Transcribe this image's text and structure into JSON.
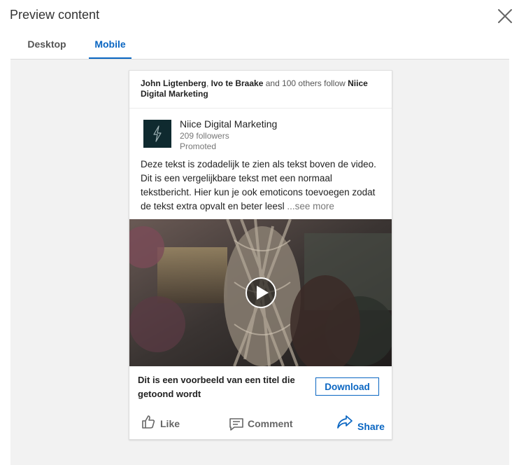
{
  "modal": {
    "title": "Preview content"
  },
  "tabs": [
    {
      "label": "Desktop",
      "active": false
    },
    {
      "label": "Mobile",
      "active": true
    }
  ],
  "post": {
    "social": {
      "name1": "John Ligtenberg",
      "sep": ", ",
      "name2": "Ivo te Braake",
      "rest": " and 100 others follow ",
      "company": "Niice Digital Marketing"
    },
    "company": {
      "name": "Niice Digital Marketing",
      "followers": "209 followers",
      "promoted": "Promoted"
    },
    "text": "Deze tekst is zodadelijk te zien als tekst boven de video. Dit is een vergelijkbare tekst met een normaal tekstbericht. Hier kun je ook emoticons toevoegen zodat de tekst extra opvalt en beter leesl",
    "see_more": "...see more",
    "headline": "Dit is een voorbeeld van een titel die getoond wordt",
    "cta": "Download",
    "actions": {
      "like": "Like",
      "comment": "Comment",
      "share": "Share"
    }
  },
  "colors": {
    "accent": "#0a66c2",
    "logo_bg": "#0f2a2f",
    "stage_bg": "#f2f2f2"
  }
}
